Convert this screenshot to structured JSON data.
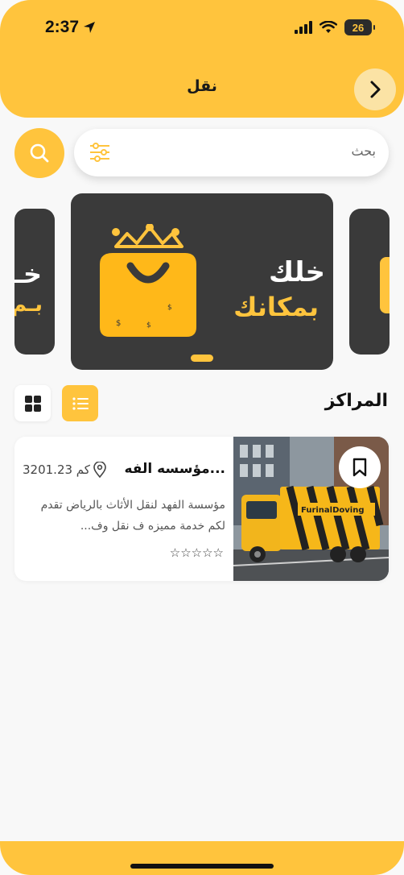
{
  "status_bar": {
    "time": "2:37",
    "battery": "26"
  },
  "header": {
    "title": "نقل"
  },
  "search": {
    "placeholder": "بحث"
  },
  "banner": {
    "line1": "خلك",
    "line2": "بمكانك",
    "side_left_line1": "خـ",
    "side_left_line2": "بـم"
  },
  "section": {
    "title": "المراكز"
  },
  "centers": [
    {
      "name": "مؤسسه الفه...",
      "distance": "3201.23 كم",
      "description": "مؤسسة الفهد لنقل الأثاث بالرياض تقدم لكم خدمة مميزه ف نقل وف...",
      "rating": "☆☆☆☆☆",
      "truck_text": "FurinalDoving"
    }
  ],
  "colors": {
    "accent": "#ffc43d",
    "dark": "#3a3a3a"
  }
}
